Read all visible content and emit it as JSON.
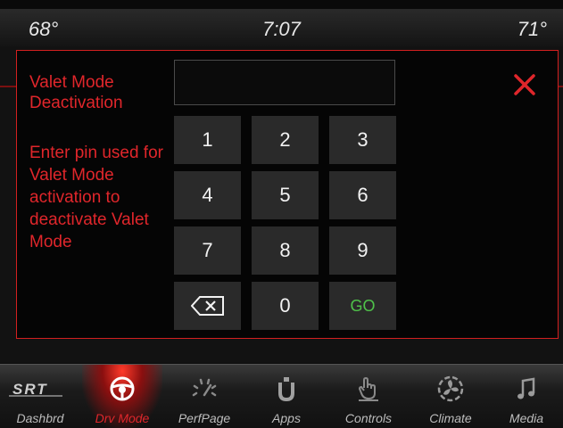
{
  "status": {
    "temp_left": "68°",
    "clock": "7:07",
    "temp_right": "71°"
  },
  "modal": {
    "title": "Valet Mode Deactivation",
    "instructions": "Enter pin used for Valet Mode activation to deactivate Valet Mode",
    "pin_value": "",
    "keys": [
      "1",
      "2",
      "3",
      "4",
      "5",
      "6",
      "7",
      "8",
      "9",
      "backspace",
      "0",
      "GO"
    ],
    "go_label": "GO",
    "close_icon": "close-x-icon",
    "accent_color": "#e0262b",
    "go_color": "#4fc24a"
  },
  "nav": {
    "items": [
      {
        "label": "Dashbrd",
        "icon": "srt-logo-icon"
      },
      {
        "label": "Drv Mode",
        "icon": "steering-wheel-icon",
        "active": true
      },
      {
        "label": "PerfPage",
        "icon": "gauge-icon"
      },
      {
        "label": "Apps",
        "icon": "apps-icon"
      },
      {
        "label": "Controls",
        "icon": "touch-controls-icon"
      },
      {
        "label": "Climate",
        "icon": "climate-fan-icon"
      },
      {
        "label": "Media",
        "icon": "music-note-icon"
      }
    ]
  }
}
